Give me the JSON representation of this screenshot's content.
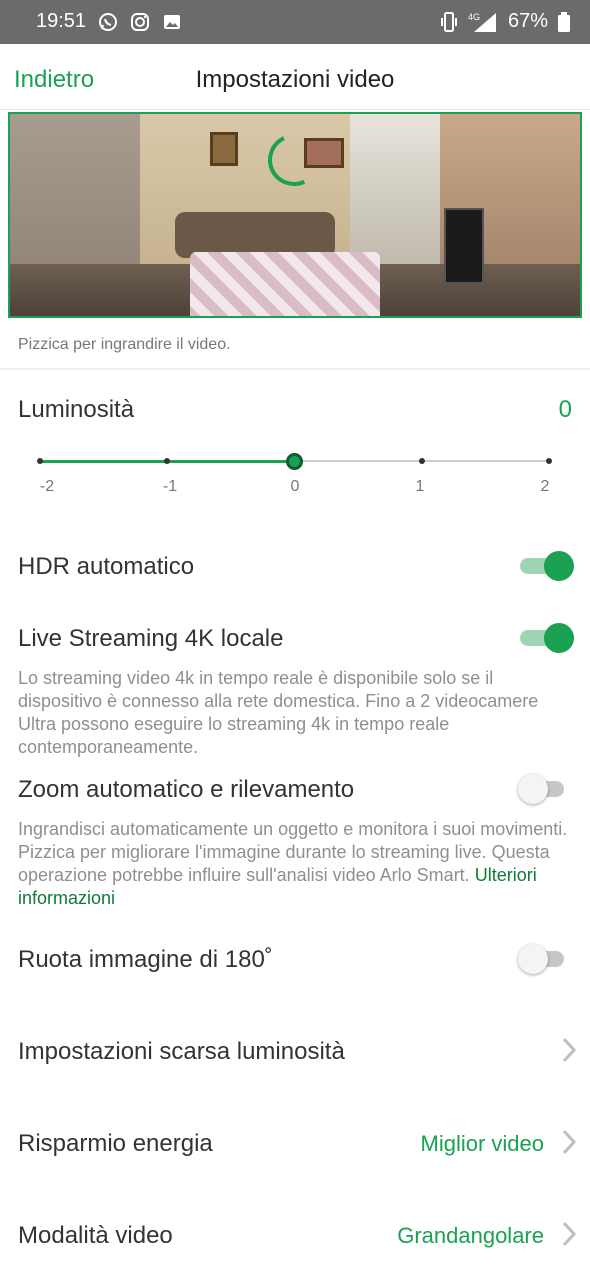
{
  "status_bar": {
    "time": "19:51",
    "left_icons": [
      "whatsapp-icon",
      "instagram-icon",
      "gallery-icon"
    ],
    "network": "4G",
    "battery": "67%"
  },
  "header": {
    "back_label": "Indietro",
    "title": "Impostazioni video"
  },
  "video": {
    "hint": "Pizzica per ingrandire il video."
  },
  "brightness": {
    "label": "Luminosità",
    "value": "0",
    "ticks": [
      "-2",
      "-1",
      "0",
      "1",
      "2"
    ],
    "selected_index": 2
  },
  "settings": {
    "hdr": {
      "label": "HDR automatico",
      "enabled": true
    },
    "live4k": {
      "label": "Live Streaming 4K locale",
      "enabled": true,
      "description": "Lo streaming video 4k in tempo reale è disponibile solo se il dispositivo è connesso alla rete domestica. Fino a 2 videocamere Ultra possono eseguire lo streaming 4k in tempo reale contemporaneamente."
    },
    "autozoom": {
      "label": "Zoom automatico e rilevamento",
      "enabled": false,
      "description": "Ingrandisci automaticamente un oggetto e monitora i suoi movimenti. Pizzica per migliorare l'immagine durante lo streaming live. Questa operazione potrebbe influire sull'analisi video Arlo Smart.",
      "link": "Ulteriori informazioni"
    },
    "rotate": {
      "label": "Ruota immagine di 180˚",
      "enabled": false
    },
    "lowlight": {
      "label": "Impostazioni scarsa luminosità"
    },
    "power": {
      "label": "Risparmio energia",
      "value": "Miglior video"
    },
    "videomode": {
      "label": "Modalità video",
      "value": "Grandangolare"
    }
  },
  "colors": {
    "accent": "#1aa152",
    "status_bar": "#6b6b6b"
  }
}
